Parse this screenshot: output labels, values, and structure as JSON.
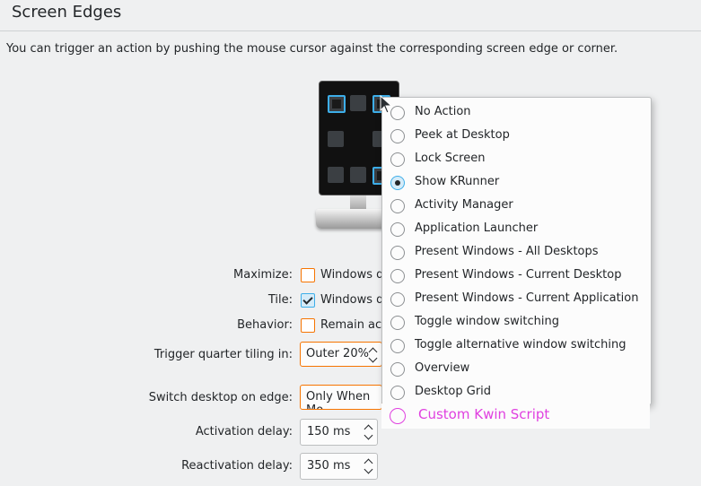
{
  "header": {
    "title": "Screen Edges"
  },
  "description": "You can trigger an action by pushing the mouse cursor against the corresponding screen edge or corner.",
  "form": {
    "maximize": {
      "label": "Maximize:",
      "text": "Windows d",
      "checked": false
    },
    "tile": {
      "label": "Tile:",
      "text": "Windows d",
      "checked": true
    },
    "behavior": {
      "label": "Behavior:",
      "text": "Remain act",
      "checked": false
    },
    "quarter_tiling": {
      "label": "Trigger quarter tiling in:",
      "value": "Outer 20%"
    },
    "switch_desktop": {
      "label": "Switch desktop on edge:",
      "value": "Only When Mo"
    },
    "activation_delay": {
      "label": "Activation delay:",
      "value": "150 ms"
    },
    "reactivation_delay": {
      "label": "Reactivation delay:",
      "value": "350 ms"
    }
  },
  "menu": {
    "items": [
      {
        "label": "No Action",
        "selected": false
      },
      {
        "label": "Peek at Desktop",
        "selected": false
      },
      {
        "label": "Lock Screen",
        "selected": false
      },
      {
        "label": "Show KRunner",
        "selected": true
      },
      {
        "label": "Activity Manager",
        "selected": false
      },
      {
        "label": "Application Launcher",
        "selected": false
      },
      {
        "label": "Present Windows - All Desktops",
        "selected": false
      },
      {
        "label": "Present Windows - Current Desktop",
        "selected": false
      },
      {
        "label": "Present Windows - Current Application",
        "selected": false
      },
      {
        "label": "Toggle window switching",
        "selected": false
      },
      {
        "label": "Toggle alternative window switching",
        "selected": false
      },
      {
        "label": "Overview",
        "selected": false
      },
      {
        "label": "Desktop Grid",
        "selected": false
      }
    ],
    "extra_item": {
      "label": "Custom Kwin Script",
      "color": "#e040e0"
    }
  },
  "colors": {
    "accent": "#3daee9",
    "focus": "#f67400"
  }
}
